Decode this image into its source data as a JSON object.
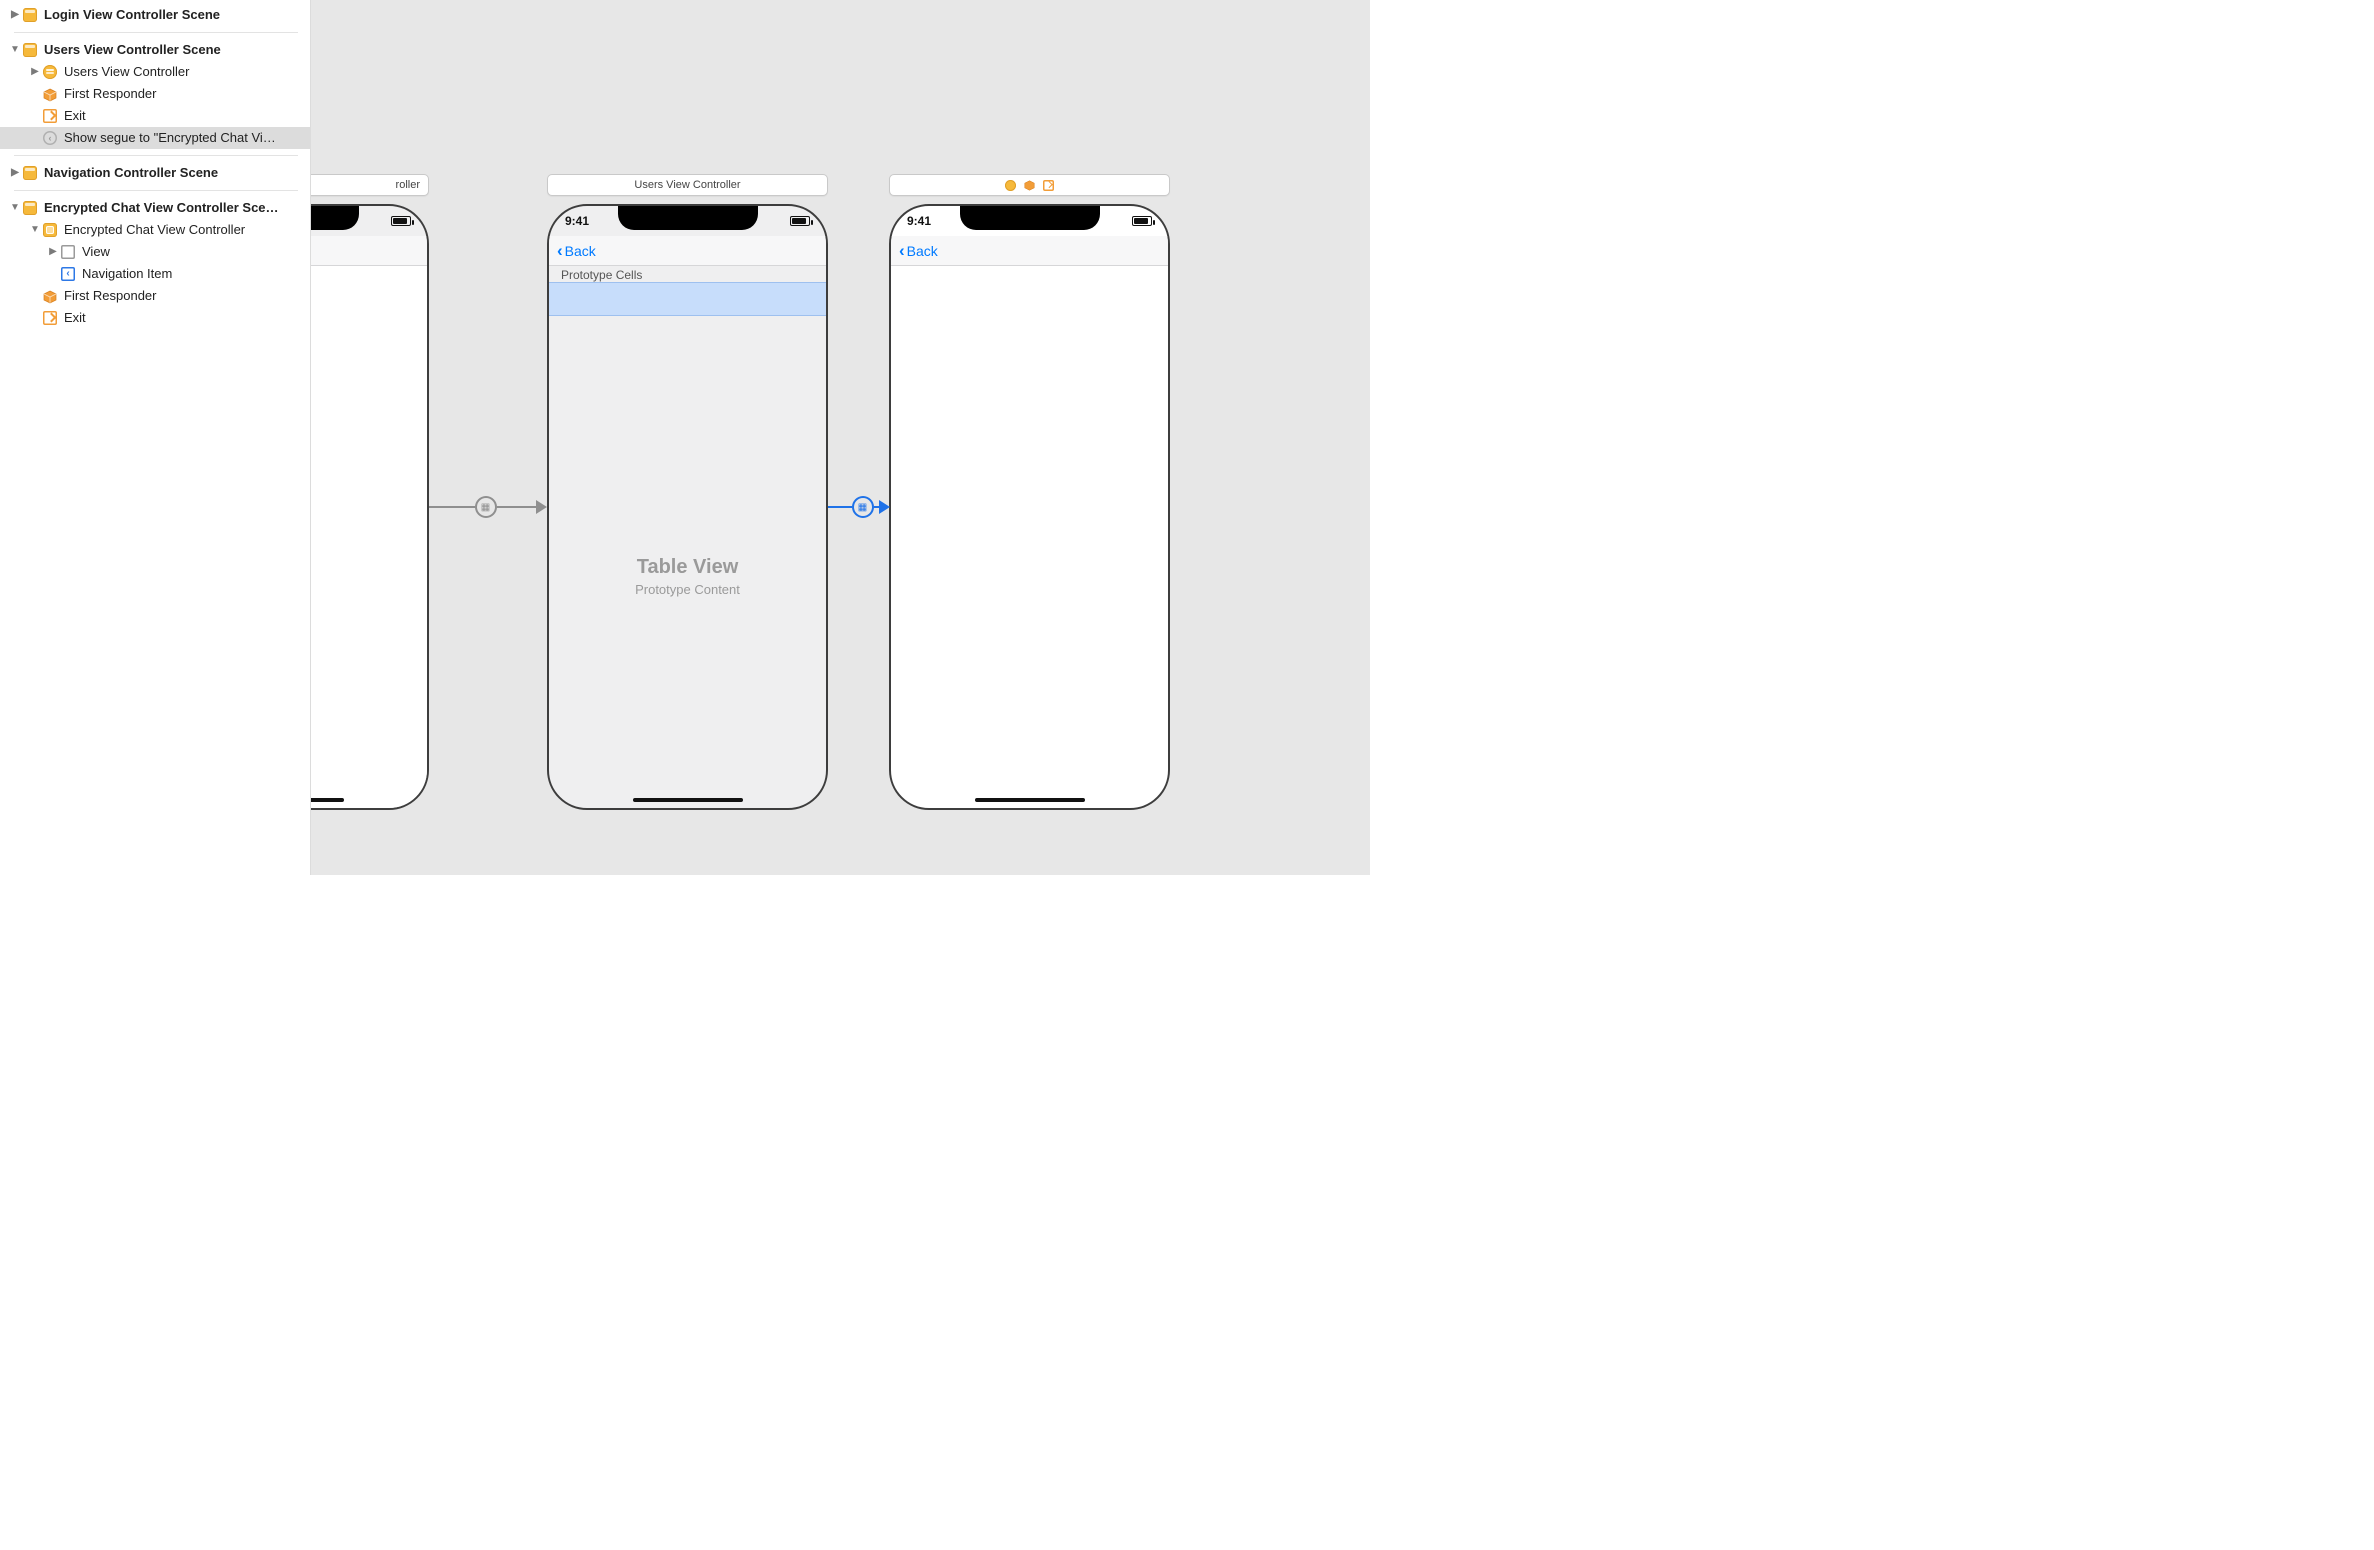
{
  "outline": {
    "login_scene": "Login View Controller Scene",
    "users_scene": "Users View Controller Scene",
    "users_vc": "Users View Controller",
    "first_responder": "First Responder",
    "exit": "Exit",
    "segue": "Show segue to \"Encrypted Chat Vi…",
    "nav_scene": "Navigation Controller Scene",
    "enc_scene": "Encrypted Chat View Controller Sce…",
    "enc_vc": "Encrypted Chat View Controller",
    "view": "View",
    "nav_item": "Navigation Item"
  },
  "canvas": {
    "title_left": "roller",
    "title_mid": "Users View Controller",
    "status_time": "9:41",
    "back_label": "Back",
    "proto_cells": "Prototype Cells",
    "tableview_title": "Table View",
    "tableview_sub": "Prototype Content"
  }
}
